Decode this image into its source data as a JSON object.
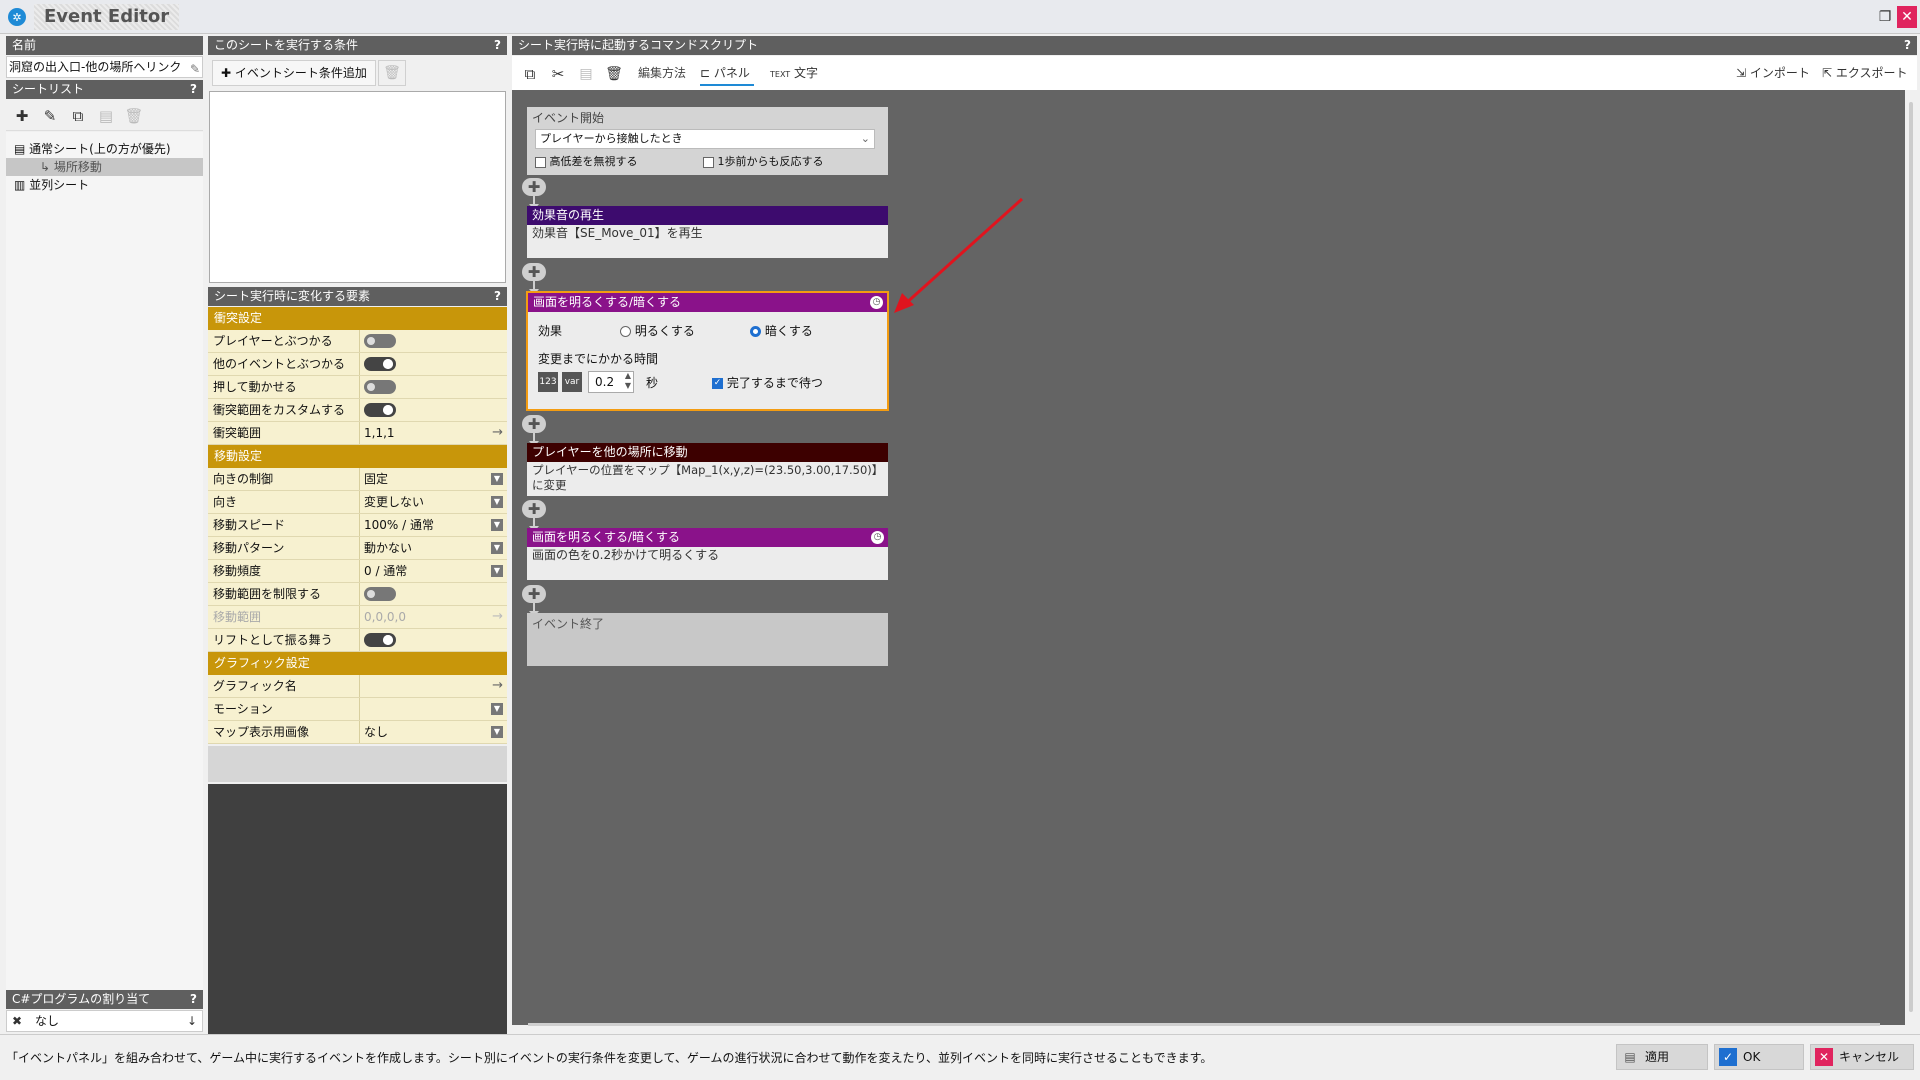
{
  "window": {
    "title": "Event Editor",
    "restore_icon": "restore-icon",
    "close_icon": "close-icon"
  },
  "name_panel": {
    "header": "名前",
    "value": "洞窟の出入口-他の場所ヘリンク"
  },
  "sheet_panel": {
    "header": "シートリスト",
    "help": "?",
    "items": [
      {
        "label": "通常シート(上の方が優先)"
      },
      {
        "label": "場所移動"
      },
      {
        "label": "並列シート"
      }
    ]
  },
  "csharp_panel": {
    "header": "C#プログラムの割り当て",
    "help": "?",
    "value": "なし"
  },
  "conditions": {
    "header": "このシートを実行する条件",
    "help": "?",
    "add_label": "イベントシート条件追加"
  },
  "elements": {
    "header": "シート実行時に変化する要素",
    "help": "?",
    "collision": {
      "title": "衝突設定",
      "rows": [
        {
          "label": "プレイヤーとぶつかる",
          "state": "off"
        },
        {
          "label": "他のイベントとぶつかる",
          "state": "on"
        },
        {
          "label": "押して動かせる",
          "state": "off"
        },
        {
          "label": "衝突範囲をカスタムする",
          "state": "on"
        },
        {
          "label": "衝突範囲",
          "value": "1,1,1"
        }
      ]
    },
    "movement": {
      "title": "移動設定",
      "rows": [
        {
          "label": "向きの制御",
          "value": "固定"
        },
        {
          "label": "向き",
          "value": "変更しない"
        },
        {
          "label": "移動スピード",
          "value": "100% / 通常"
        },
        {
          "label": "移動パターン",
          "value": "動かない"
        },
        {
          "label": "移動頻度",
          "value": "0 / 通常"
        },
        {
          "label": "移動範囲を制限する",
          "state": "off"
        },
        {
          "label": "移動範囲",
          "value": "0,0,0,0"
        },
        {
          "label": "リフトとして振る舞う",
          "state": "on"
        }
      ]
    },
    "graphics": {
      "title": "グラフィック設定",
      "rows": [
        {
          "label": "グラフィック名",
          "value": ""
        },
        {
          "label": "モーション",
          "value": ""
        },
        {
          "label": "マップ表示用画像",
          "value": "なし"
        }
      ]
    }
  },
  "script": {
    "header": "シート実行時に起動するコマンドスクリプト",
    "help": "?",
    "toolbar": {
      "edit_method": "編集方法",
      "panel": "パネル",
      "text": "文字",
      "import": "インポート",
      "export": "エクスポート"
    },
    "event_start": {
      "title": "イベント開始",
      "trigger": "プレイヤーから接触したとき",
      "ignore_height": "高低差を無視する",
      "one_step": "1歩前からも反応する"
    },
    "sound": {
      "title": "効果音の再生",
      "body": "効果音【SE_Move_01】を再生",
      "color": "#3d0b6e"
    },
    "fade_edit": {
      "title": "画面を明るくする/暗くする",
      "effect_label": "効果",
      "brighten": "明るくする",
      "darken": "暗くする",
      "selected": "暗くする",
      "time_label": "変更までにかかる時間",
      "time_value": "0.2",
      "unit": "秒",
      "wait_label": "完了するまで待つ",
      "var_label": "var",
      "num_label": "123",
      "color": "#8a128a",
      "border_color": "#f39c12"
    },
    "move": {
      "title": "プレイヤーを他の場所に移動",
      "body": "プレイヤーの位置をマップ【Map_1(x,y,z)=(23.50,3.00,17.50)】に変更",
      "color": "#3d0000"
    },
    "fade2": {
      "title": "画面を明るくする/暗くする",
      "body": "画面の色を0.2秒かけて明るくする",
      "color": "#8a128a"
    },
    "event_end": {
      "title": "イベント終了"
    },
    "annotation_color": "#e0141e"
  },
  "status": {
    "text": "「イベントパネル」を組み合わせて、ゲーム中に実行するイベントを作成します。シート別にイベントの実行条件を変更して、ゲームの進行状況に合わせて動作を変えたり、並列イベントを同時に実行させることもできます。"
  },
  "buttons": {
    "apply": "適用",
    "ok": "OK",
    "cancel": "キャンセル"
  }
}
